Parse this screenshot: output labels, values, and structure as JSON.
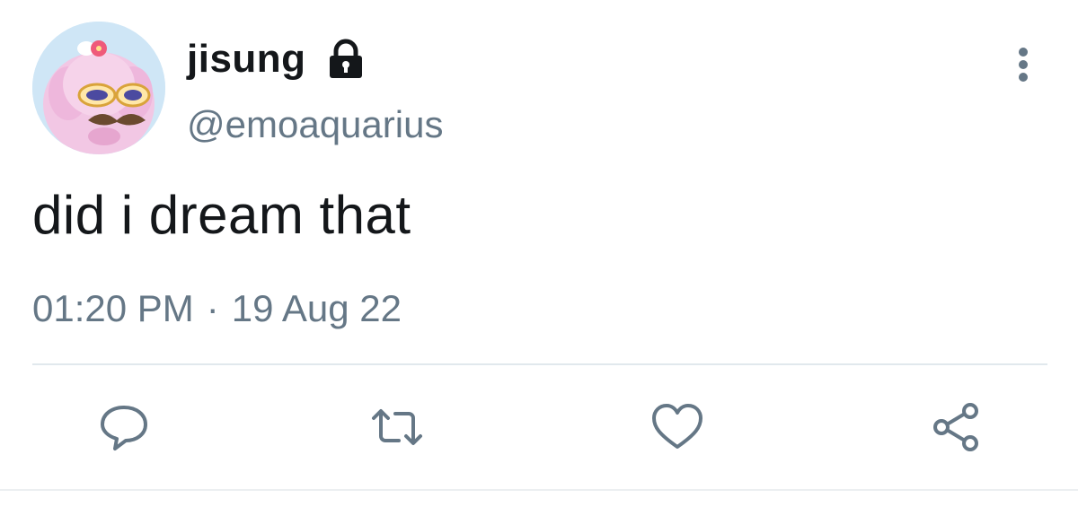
{
  "tweet": {
    "display_name": "jisung",
    "handle": "@emoaquarius",
    "text": "did i dream that",
    "time": "01:20 PM",
    "separator": "·",
    "date": "19 Aug 22"
  },
  "icons": {
    "lock": "lock-icon",
    "more": "more-vertical-icon",
    "reply": "reply-icon",
    "retweet": "retweet-icon",
    "like": "heart-icon",
    "share": "share-icon"
  },
  "colors": {
    "text": "#14171a",
    "secondary": "#657786",
    "icon": "#657786",
    "divider": "#e1e8ed"
  }
}
